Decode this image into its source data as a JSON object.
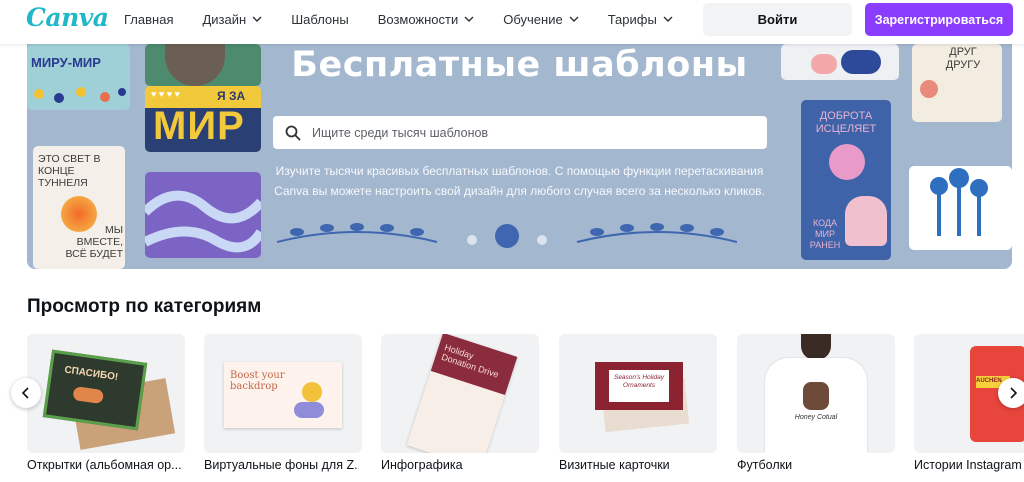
{
  "header": {
    "logo": "Canva",
    "nav": [
      {
        "label": "Главная",
        "dropdown": false
      },
      {
        "label": "Дизайн",
        "dropdown": true
      },
      {
        "label": "Шаблоны",
        "dropdown": false
      },
      {
        "label": "Возможности",
        "dropdown": true
      },
      {
        "label": "Обучение",
        "dropdown": true
      },
      {
        "label": "Тарифы",
        "dropdown": true
      }
    ],
    "login_label": "Войти",
    "signup_label": "Зарегистрироваться"
  },
  "hero": {
    "title": "Бесплатные шаблоны",
    "search_placeholder": "Ищите среди тысяч шаблонов",
    "description": "Изучите тысячи красивых бесплатных шаблонов. С помощью функции перетаскивания Canva вы можете настроить свой дизайн для любого случая всего за несколько кликов.",
    "decor_cards": {
      "left_top": "МИРУ-МИР",
      "left_mid_badge": "Я ЗА",
      "left_mid_main": "МИР",
      "left_bottom": "ЭТО СВЕТ В КОНЦЕ ТУННЕЛЯ",
      "left_bottom_sub": "МЫ ВМЕСТЕ, ВСЁ БУДЕТ",
      "right_top": "ДРУГ ДРУГУ",
      "right_mid": "ДОБРОТА ИСЦЕЛЯЕТ",
      "right_mid_sub": "КОДА МИР РАНЕН"
    }
  },
  "categories": {
    "title": "Просмотр по категориям",
    "items": [
      {
        "label": "Открытки (альбомная ор...",
        "image_text": "СПАСИБО!"
      },
      {
        "label": "Виртуальные фоны для Z...",
        "image_text": "Boost your backdrop"
      },
      {
        "label": "Инфографика",
        "image_text": "Holiday Donation Drive"
      },
      {
        "label": "Визитные карточки",
        "image_text": "Season's Holiday Ornaments"
      },
      {
        "label": "Футболки",
        "image_text": "Honey Cotual"
      },
      {
        "label": "Истории Instagram",
        "image_text": "AUCHEN"
      }
    ]
  },
  "colors": {
    "brand": "#20b8c9",
    "primary": "#8b3dff",
    "hero_bg": "#a3b7cf"
  }
}
